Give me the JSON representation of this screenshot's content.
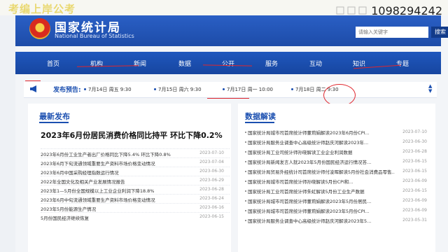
{
  "watermark": "考编上岸公考",
  "corner_number": "1098294242",
  "header": {
    "title": "国家统计局",
    "subtitle": "National Bureau of Statistics",
    "search_placeholder": "请输入关键字",
    "search_button": "搜索"
  },
  "nav": {
    "items": [
      "首页",
      "机构",
      "新闻",
      "数据",
      "公开",
      "服务",
      "互动",
      "知识",
      "专题"
    ],
    "active": "数据"
  },
  "notice": {
    "label": "发布预告:",
    "dates": [
      "7月14日 周五 9:30",
      "7月15日 周六 9:30",
      "7月17日 周一 10:00",
      "7月18日 周二 9:30"
    ],
    "scroll_up_icon": "chevron-up-icon",
    "scroll_down_icon": "chevron-down-icon"
  },
  "latest": {
    "title": "最新发布",
    "headline": "2023年6月份居民消费价格同比持平 环比下降0.2%",
    "items": [
      {
        "title": "2023年6月份工业生产者出厂价格同比下降5.4% 环比下降0.8%",
        "date": "2023-07-10"
      },
      {
        "title": "2023年6月下旬流通领域重要生产资料市场价格变动情况",
        "date": "2023-07-04"
      },
      {
        "title": "2023年6月中国采购经理指数运行情况",
        "date": "2023-06-30"
      },
      {
        "title": "2022年全国文化及相关产业发展情况报告",
        "date": "2023-06-29"
      },
      {
        "title": "2023年1—5月份全国规模以上工业企业利润下降18.8%",
        "date": "2023-06-28"
      },
      {
        "title": "2023年6月中旬流通领域重要生产资料市场价格变动情况",
        "date": "2023-06-24"
      },
      {
        "title": "2023年5月份能源生产情况",
        "date": "2023-06-16"
      },
      {
        "title": "5月份国民经济继续恢复",
        "date": "2023-06-15"
      }
    ]
  },
  "interpret": {
    "title": "数据解读",
    "items": [
      {
        "title": "国家统计局城市司首席统计师董莉娟解读2023年6月份CPI...",
        "date": "2023-07-10"
      },
      {
        "title": "国家统计局服务业调查中心高级统计师赵庆河解读2023年...",
        "date": "2023-06-30"
      },
      {
        "title": "国家统计局工业司统计师孙晓解读工业企业利润数据",
        "date": "2023-06-28"
      },
      {
        "title": "国家统计局新闻发言人就2023年5月份国民经济运行情况答...",
        "date": "2023-06-15"
      },
      {
        "title": "国家统计局贸易外经统计司首席统计师付凌晖解读5月份社会消费品零售...",
        "date": "2023-06-15"
      },
      {
        "title": "国家统计局城市司首席统计师孙晓解读5月份CPI和...",
        "date": "2023-06-09"
      },
      {
        "title": "国家统计局工业司首席统计师朱虹解读5月份工业生产数据",
        "date": "2023-06-15"
      },
      {
        "title": "国家统计局城市司首席统计师董莉娟解读2023年5月份居民...",
        "date": "2023-06-09"
      },
      {
        "title": "国家统计局城市司首席统计师董莉娟解读2023年5月份CPI...",
        "date": "2023-06-09"
      },
      {
        "title": "国家统计局服务业调查中心高级统计师赵庆河解读2023年5...",
        "date": "2023-05-31"
      }
    ]
  },
  "colors": {
    "brand_blue": "#1d4ca8",
    "annotation_red": "#e0262e"
  }
}
